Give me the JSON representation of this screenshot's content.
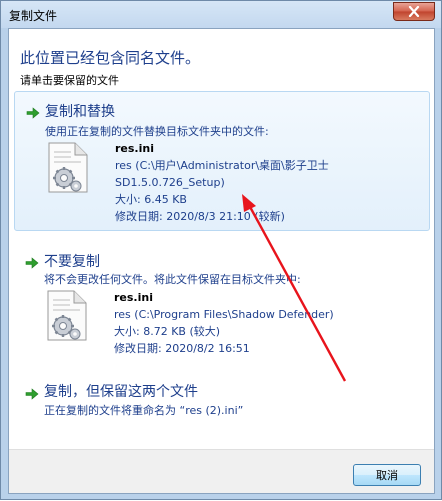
{
  "window": {
    "title": "复制文件",
    "heading": "此位置已经包含同名文件。",
    "subheading": "请单击要保留的文件"
  },
  "options": {
    "replace": {
      "title": "复制和替换",
      "description": "使用正在复制的文件替换目标文件夹中的文件:",
      "file": {
        "name": "res.ini",
        "path_line1": "res (C:\\用户\\Administrator\\桌面\\影子卫士",
        "path_line2": "SD1.5.0.726_Setup)",
        "size": "大小: 6.45 KB",
        "modified": "修改日期: 2020/8/3 21:10 (较新)"
      }
    },
    "skip": {
      "title": "不要复制",
      "description": "将不会更改任何文件。将此文件保留在目标文件夹中:",
      "file": {
        "name": "res.ini",
        "path_line1": "res (C:\\Program Files\\Shadow Defender)",
        "size": "大小: 8.72 KB (较大)",
        "modified": "修改日期: 2020/8/2 16:51"
      }
    },
    "keep_both": {
      "title": "复制，但保留这两个文件",
      "description": "正在复制的文件将重命名为 “res (2).ini”"
    }
  },
  "buttons": {
    "cancel": "取消"
  },
  "colors": {
    "link_blue": "#1e3f8c",
    "arrow_green": "#2e9e2e",
    "annotation_red": "#e8141c"
  },
  "icons": [
    "close-icon",
    "green-arrow-icon",
    "ini-file-gear-icon"
  ]
}
